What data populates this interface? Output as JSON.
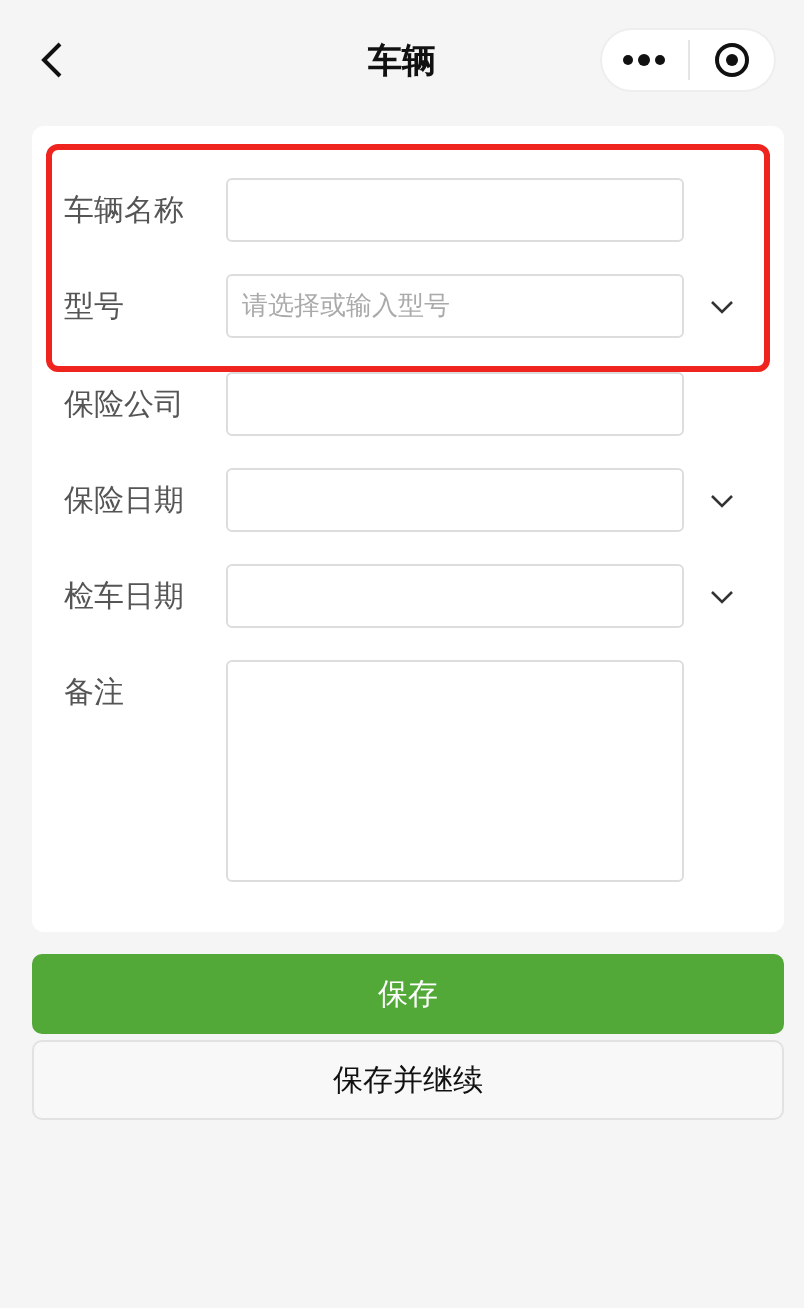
{
  "header": {
    "title": "车辆"
  },
  "fields": [
    {
      "label": "车辆名称",
      "kind": "text",
      "highlighted": true
    },
    {
      "label": "型号",
      "kind": "select",
      "placeholder": "请选择或输入型号",
      "highlighted": true
    },
    {
      "label": "保险公司",
      "kind": "text",
      "highlighted": false
    },
    {
      "label": "保险日期",
      "kind": "select",
      "highlighted": false
    },
    {
      "label": "检车日期",
      "kind": "select",
      "highlighted": false
    },
    {
      "label": "备注",
      "kind": "textarea",
      "highlighted": false
    }
  ],
  "buttons": [
    {
      "label": "保存",
      "kind": "primary"
    },
    {
      "label": "保存并继续",
      "kind": "secondary"
    }
  ]
}
